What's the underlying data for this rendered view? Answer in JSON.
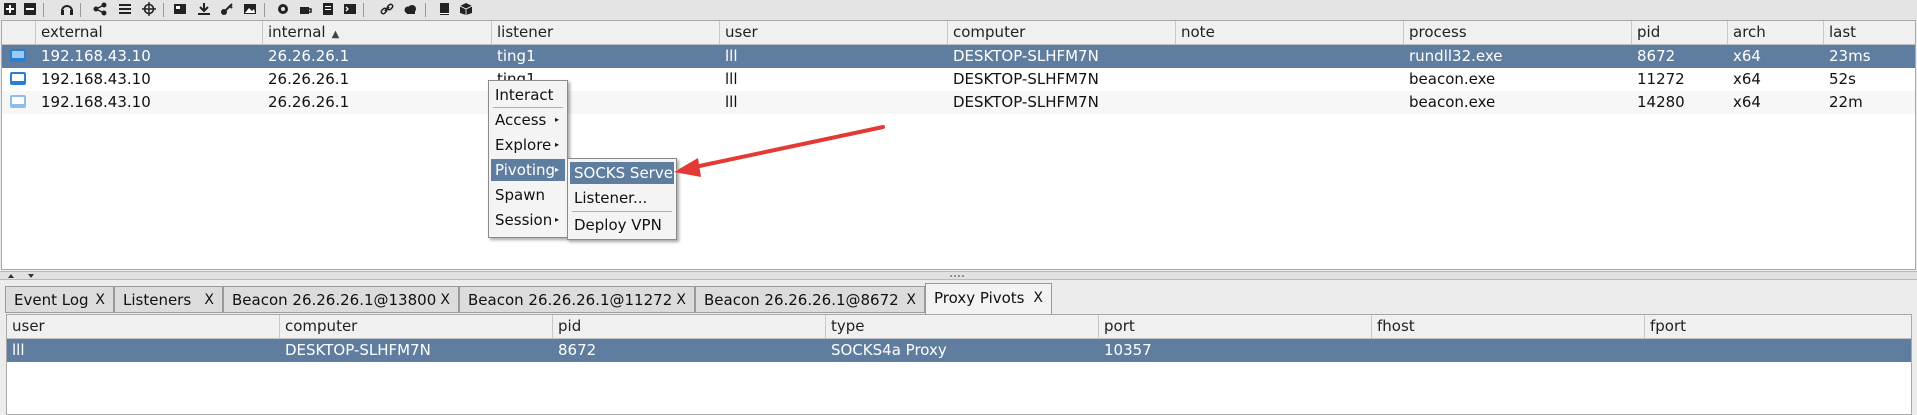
{
  "toolbar": {
    "icons": [
      "plus-icon",
      "minus-icon",
      "headphones-icon",
      "share-icon",
      "list-icon",
      "crosshair-icon",
      "card-icon",
      "download-icon",
      "key-icon",
      "image-icon",
      "gear-icon",
      "coffee-icon",
      "document-icon",
      "terminal-icon",
      "link-icon",
      "cloud-icon",
      "book-icon",
      "package-icon"
    ]
  },
  "sessions": {
    "columns": [
      "external",
      "internal",
      "listener",
      "user",
      "computer",
      "note",
      "process",
      "pid",
      "arch",
      "last"
    ],
    "sort_indicator": "▲",
    "rows": [
      {
        "external": "192.168.43.10",
        "internal": "26.26.26.1",
        "listener": "ting1",
        "user": "lll",
        "computer": "DESKTOP-SLHFM7N",
        "note": "",
        "process": "rundll32.exe",
        "pid": "8672",
        "arch": "x64",
        "last": "23ms",
        "selected": true
      },
      {
        "external": "192.168.43.10",
        "internal": "26.26.26.1",
        "listener": "ting1",
        "user": "lll",
        "computer": "DESKTOP-SLHFM7N",
        "note": "",
        "process": "beacon.exe",
        "pid": "11272",
        "arch": "x64",
        "last": "52s",
        "selected": false
      },
      {
        "external": "192.168.43.10",
        "internal": "26.26.26.1",
        "listener": "",
        "user": "lll",
        "computer": "DESKTOP-SLHFM7N",
        "note": "",
        "process": "beacon.exe",
        "pid": "14280",
        "arch": "x64",
        "last": "22m",
        "selected": false
      }
    ]
  },
  "context_menu": {
    "items": [
      "Interact",
      "Access",
      "Explore",
      "Pivoting",
      "Spawn",
      "Session"
    ],
    "highlighted": "Pivoting"
  },
  "submenu": {
    "items": [
      "SOCKS Server",
      "Listener...",
      "Deploy VPN"
    ],
    "highlighted": "SOCKS Server"
  },
  "tabs": [
    {
      "label": "Event Log",
      "close": "X"
    },
    {
      "label": "Listeners",
      "close": "X"
    },
    {
      "label": "Beacon 26.26.26.1@13800",
      "close": "X"
    },
    {
      "label": "Beacon 26.26.26.1@11272",
      "close": "X"
    },
    {
      "label": "Beacon 26.26.26.1@8672",
      "close": "X"
    },
    {
      "label": "Proxy Pivots",
      "close": "X",
      "active": true
    }
  ],
  "proxy_pivots": {
    "columns": [
      "user",
      "computer",
      "pid",
      "type",
      "port",
      "fhost",
      "fport"
    ],
    "rows": [
      {
        "user": "lll",
        "computer": "DESKTOP-SLHFM7N",
        "pid": "8672",
        "type": "SOCKS4a Proxy",
        "port": "10357",
        "fhost": "",
        "fport": ""
      }
    ]
  },
  "colors": {
    "selection": "#5f7d9e",
    "arrow": "#e53935",
    "beacon_icon": "#2b7fd0",
    "beacon_icon_dim": "#8fbde6"
  }
}
